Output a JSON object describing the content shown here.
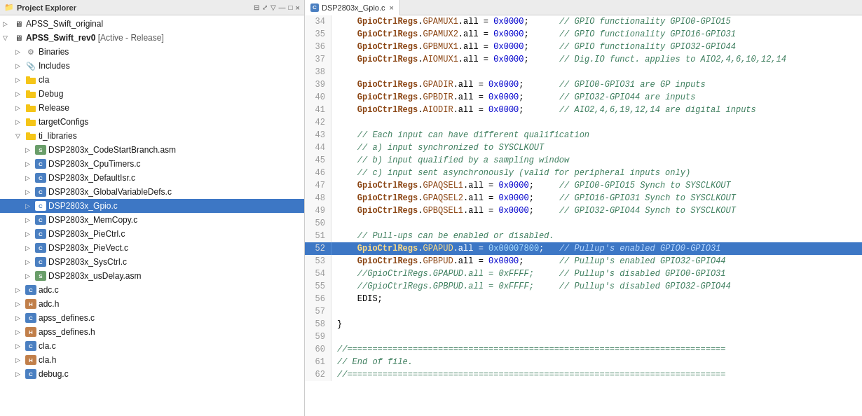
{
  "panels": {
    "left": {
      "title": "Project Explorer",
      "close_label": "×"
    },
    "right": {
      "tab_label": "DSP2803x_Gpio.c",
      "close_label": "×"
    }
  },
  "tree": {
    "items": [
      {
        "id": "apss-swift-original",
        "label": "APSS_Swift_original",
        "type": "project",
        "indent": 0,
        "arrow": "▷"
      },
      {
        "id": "apss-swift-rev0",
        "label": "APSS_Swift_rev0  [Active - Release]",
        "type": "project",
        "indent": 0,
        "arrow": "▽"
      },
      {
        "id": "binaries",
        "label": "Binaries",
        "type": "binaries",
        "indent": 1,
        "arrow": "▷"
      },
      {
        "id": "includes",
        "label": "Includes",
        "type": "includes",
        "indent": 1,
        "arrow": "▷"
      },
      {
        "id": "cla",
        "label": "cla",
        "type": "folder",
        "indent": 1,
        "arrow": "▷"
      },
      {
        "id": "debug",
        "label": "Debug",
        "type": "folder",
        "indent": 1,
        "arrow": "▷"
      },
      {
        "id": "release",
        "label": "Release",
        "type": "folder",
        "indent": 1,
        "arrow": "▷"
      },
      {
        "id": "targetconfigs",
        "label": "targetConfigs",
        "type": "folder",
        "indent": 1,
        "arrow": "▷"
      },
      {
        "id": "ti-libraries",
        "label": "ti_libraries",
        "type": "folder-open",
        "indent": 1,
        "arrow": "▽"
      },
      {
        "id": "codestartbranch",
        "label": "DSP2803x_CodeStartBranch.asm",
        "type": "asm",
        "indent": 2,
        "arrow": "▷"
      },
      {
        "id": "cputimers",
        "label": "DSP2803x_CpuTimers.c",
        "type": "c",
        "indent": 2,
        "arrow": "▷"
      },
      {
        "id": "defaultisr",
        "label": "DSP2803x_DefaultIsr.c",
        "type": "c",
        "indent": 2,
        "arrow": "▷"
      },
      {
        "id": "globalvariabledefs",
        "label": "DSP2803x_GlobalVariableDefs.c",
        "type": "c",
        "indent": 2,
        "arrow": "▷"
      },
      {
        "id": "gpio",
        "label": "DSP2803x_Gpio.c",
        "type": "c",
        "indent": 2,
        "arrow": "▷",
        "selected": true
      },
      {
        "id": "memcopy",
        "label": "DSP2803x_MemCopy.c",
        "type": "c",
        "indent": 2,
        "arrow": "▷"
      },
      {
        "id": "piectrl",
        "label": "DSP2803x_PieCtrl.c",
        "type": "c",
        "indent": 2,
        "arrow": "▷"
      },
      {
        "id": "pievect",
        "label": "DSP2803x_PieVect.c",
        "type": "c",
        "indent": 2,
        "arrow": "▷"
      },
      {
        "id": "sysctrl",
        "label": "DSP2803x_SysCtrl.c",
        "type": "c",
        "indent": 2,
        "arrow": "▷"
      },
      {
        "id": "usdelay",
        "label": "DSP2803x_usDelay.asm",
        "type": "asm",
        "indent": 2,
        "arrow": "▷"
      },
      {
        "id": "adc-c",
        "label": "adc.c",
        "type": "c",
        "indent": 1,
        "arrow": "▷"
      },
      {
        "id": "adc-h",
        "label": "adc.h",
        "type": "h",
        "indent": 1,
        "arrow": "▷"
      },
      {
        "id": "apss-defines-c",
        "label": "apss_defines.c",
        "type": "c",
        "indent": 1,
        "arrow": "▷"
      },
      {
        "id": "apss-defines-h",
        "label": "apss_defines.h",
        "type": "h",
        "indent": 1,
        "arrow": "▷"
      },
      {
        "id": "cla-c",
        "label": "cla.c",
        "type": "c",
        "indent": 1,
        "arrow": "▷"
      },
      {
        "id": "cla-h",
        "label": "cla.h",
        "type": "h",
        "indent": 1,
        "arrow": "▷"
      },
      {
        "id": "debug-c",
        "label": "debug.c",
        "type": "c",
        "indent": 1,
        "arrow": "▷"
      }
    ]
  },
  "code": {
    "lines": [
      {
        "num": 34,
        "content": "    GpioCtrlRegs.GPAMUX1.all = 0x0000;      // GPIO functionality GPIO0-GPIO15",
        "highlight": false
      },
      {
        "num": 35,
        "content": "    GpioCtrlRegs.GPAMUX2.all = 0x0000;      // GPIO functionality GPIO16-GPIO31",
        "highlight": false
      },
      {
        "num": 36,
        "content": "    GpioCtrlRegs.GPBMUX1.all = 0x0000;      // GPIO functionality GPIO32-GPIO44",
        "highlight": false
      },
      {
        "num": 37,
        "content": "    GpioCtrlRegs.AIOMUX1.all = 0x0000;      // Dig.IO funct. applies to AIO2,4,6,10,12,14",
        "highlight": false
      },
      {
        "num": 38,
        "content": "",
        "highlight": false
      },
      {
        "num": 39,
        "content": "    GpioCtrlRegs.GPADIR.all = 0x0000;       // GPIO0-GPIO31 are GP inputs",
        "highlight": false
      },
      {
        "num": 40,
        "content": "    GpioCtrlRegs.GPBDIR.all = 0x0000;       // GPIO32-GPIO44 are inputs",
        "highlight": false
      },
      {
        "num": 41,
        "content": "    GpioCtrlRegs.AIODIR.all = 0x0000;       // AIO2,4,6,19,12,14 are digital inputs",
        "highlight": false
      },
      {
        "num": 42,
        "content": "",
        "highlight": false
      },
      {
        "num": 43,
        "content": "    // Each input can have different qualification",
        "highlight": false
      },
      {
        "num": 44,
        "content": "    // a) input synchronized to SYSCLKOUT",
        "highlight": false
      },
      {
        "num": 45,
        "content": "    // b) input qualified by a sampling window",
        "highlight": false
      },
      {
        "num": 46,
        "content": "    // c) input sent asynchronously (valid for peripheral inputs only)",
        "highlight": false
      },
      {
        "num": 47,
        "content": "    GpioCtrlRegs.GPAQSEL1.all = 0x0000;     // GPIO0-GPIO15 Synch to SYSCLKOUT",
        "highlight": false
      },
      {
        "num": 48,
        "content": "    GpioCtrlRegs.GPAQSEL2.all = 0x0000;     // GPIO16-GPIO31 Synch to SYSCLKOUT",
        "highlight": false
      },
      {
        "num": 49,
        "content": "    GpioCtrlRegs.GPBQSEL1.all = 0x0000;     // GPIO32-GPIO44 Synch to SYSCLKOUT",
        "highlight": false
      },
      {
        "num": 50,
        "content": "",
        "highlight": false
      },
      {
        "num": 51,
        "content": "    // Pull-ups can be enabled or disabled.",
        "highlight": false
      },
      {
        "num": 52,
        "content": "    GpioCtrlRegs.GPAPUD.all = 0x00007800;   // Pullup's enabled GPIO0-GPIO31",
        "highlight": true
      },
      {
        "num": 53,
        "content": "    GpioCtrlRegs.GPBPUD.all = 0x0000;       // Pullup's enabled GPIO32-GPIO44",
        "highlight": false
      },
      {
        "num": 54,
        "content": "    //GpioCtrlRegs.GPAPUD.all = 0xFFFF;     // Pullup's disabled GPIO0-GPIO31",
        "highlight": false
      },
      {
        "num": 55,
        "content": "    //GpioCtrlRegs.GPBPUD.all = 0xFFFF;     // Pullup's disabled GPIO32-GPIO44",
        "highlight": false
      },
      {
        "num": 56,
        "content": "    EDIS;",
        "highlight": false
      },
      {
        "num": 57,
        "content": "",
        "highlight": false
      },
      {
        "num": 58,
        "content": "}",
        "highlight": false
      },
      {
        "num": 59,
        "content": "",
        "highlight": false
      },
      {
        "num": 60,
        "content": "//===========================================================================",
        "highlight": false
      },
      {
        "num": 61,
        "content": "// End of file.",
        "highlight": false
      },
      {
        "num": 62,
        "content": "//===========================================================================",
        "highlight": false
      }
    ]
  }
}
